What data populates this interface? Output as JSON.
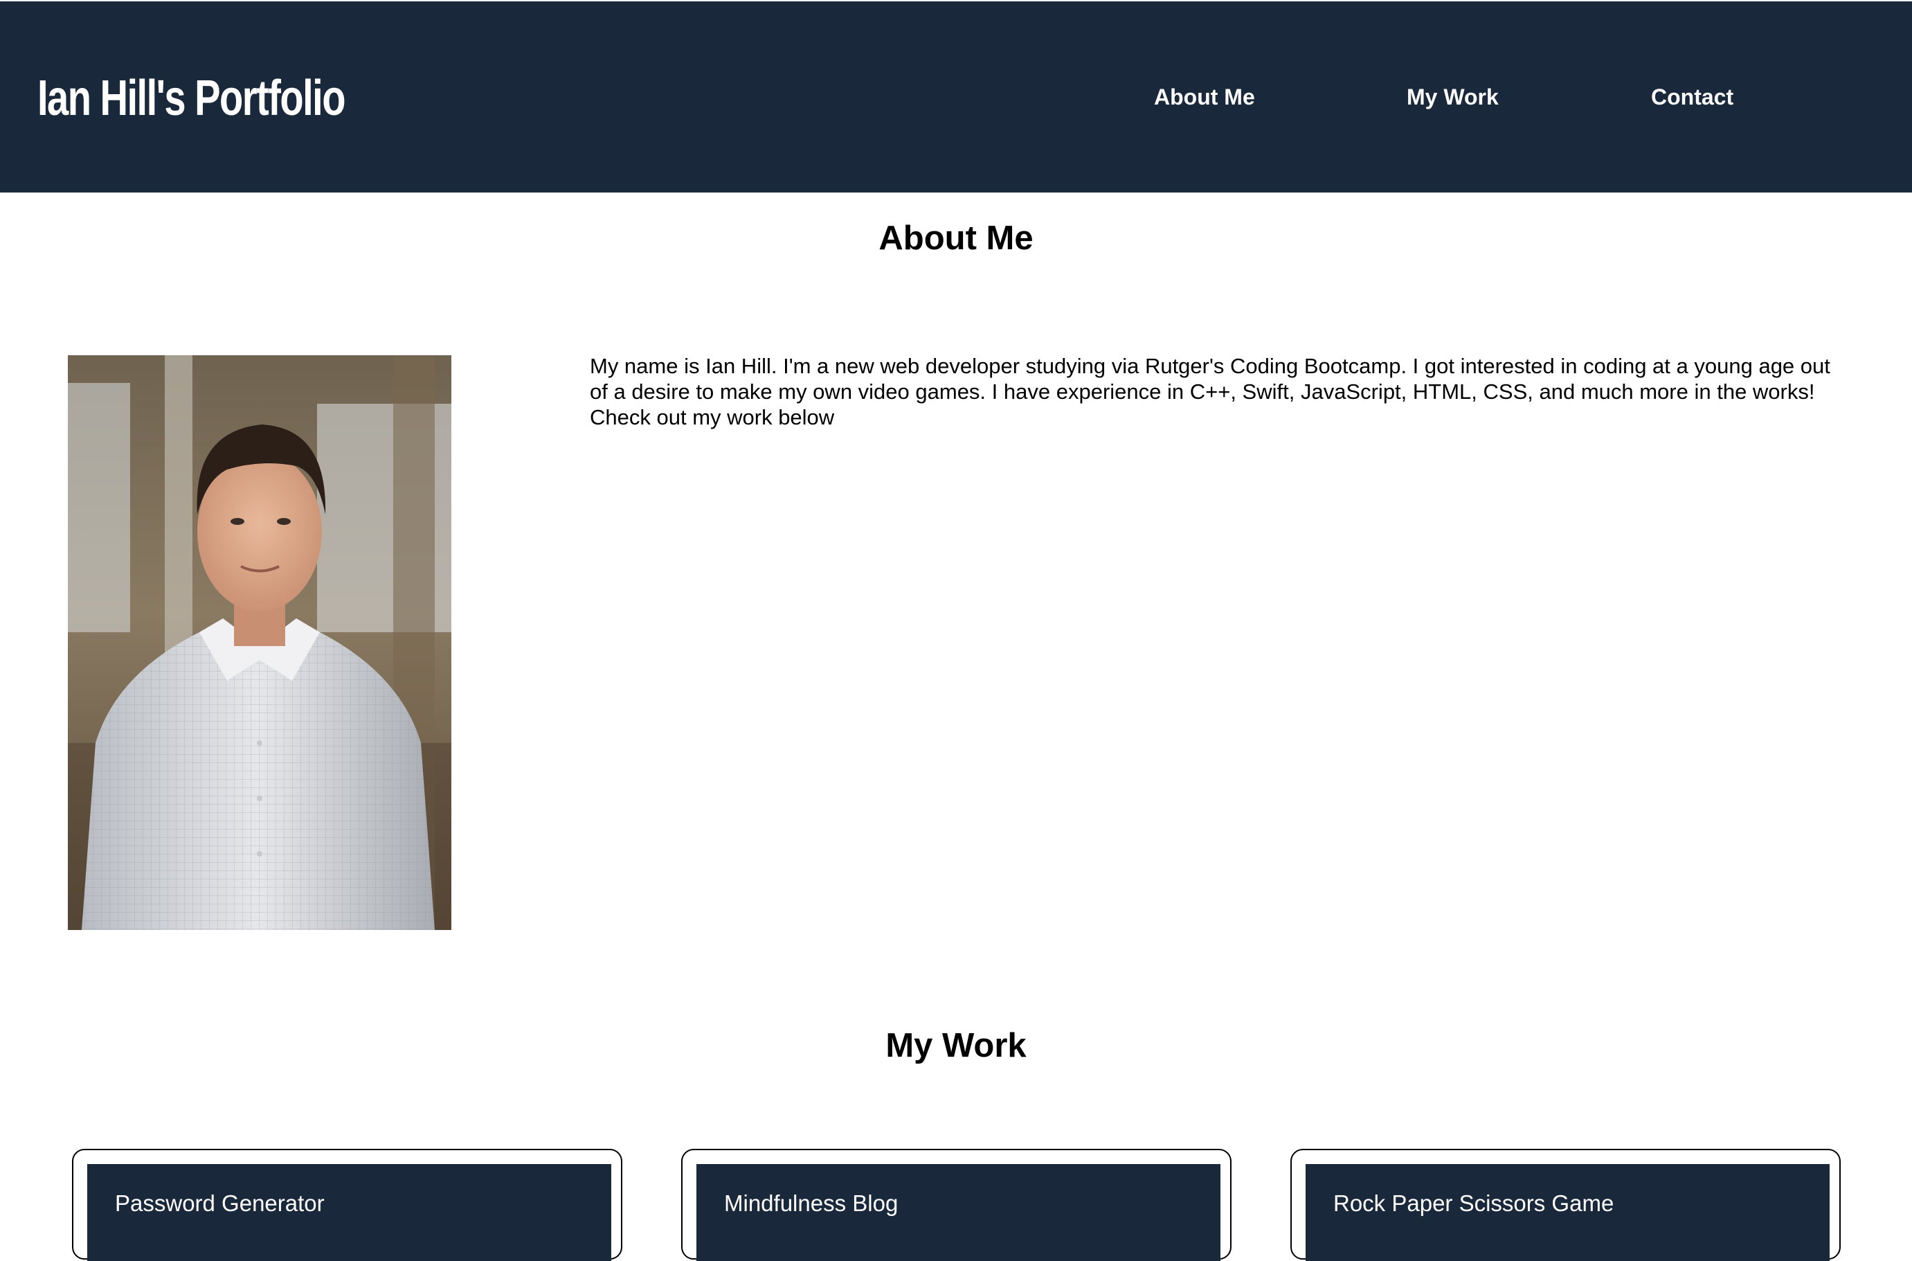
{
  "header": {
    "title": "Ian Hill's Portfolio",
    "nav": [
      "About Me",
      "My Work",
      "Contact"
    ]
  },
  "about": {
    "heading": "About Me",
    "text": "My name is Ian Hill. I'm a new web developer studying via Rutger's Coding Bootcamp. I got interested in coding at a young age out of a desire to make my own video games. I have experience in C++, Swift, JavaScript, HTML, CSS, and much more in the works! Check out my work below"
  },
  "work": {
    "heading": "My Work",
    "projects": [
      "Password Generator",
      "Mindfulness Blog",
      "Rock Paper Scissors Game"
    ]
  },
  "colors": {
    "header_bg": "#19283a",
    "header_text": "#ffffff",
    "body_bg": "#ffffff",
    "card_bar": "#19283a"
  }
}
